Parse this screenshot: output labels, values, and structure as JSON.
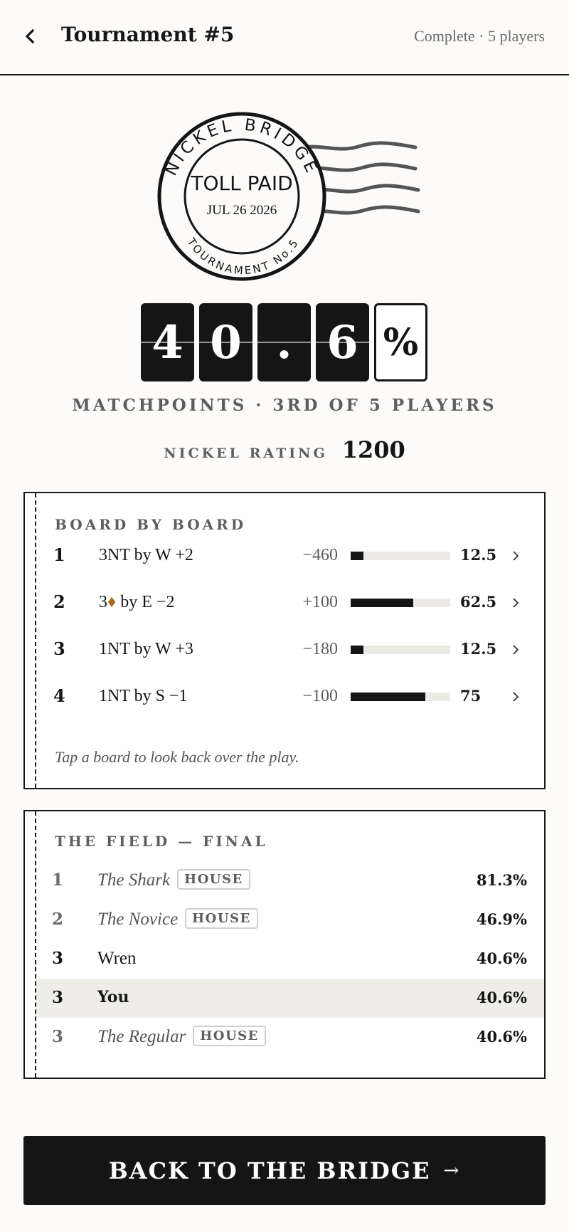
{
  "header": {
    "title": "Tournament #5",
    "status": "Complete · 5 players"
  },
  "stamp": {
    "ring_top": "NICKEL BRIDGE",
    "ring_bottom": "TOURNAMENT No.5",
    "center": "TOLL PAID",
    "date": "JUL 26 2026"
  },
  "score": {
    "digits": [
      "4",
      "0",
      ".",
      "6"
    ],
    "suffix": "%",
    "value_percent": 40.6,
    "summary": "MATCHPOINTS · 3RD OF 5 PLAYERS"
  },
  "rating": {
    "label": "NICKEL RATING",
    "value": "1200"
  },
  "boards": {
    "title": "BOARD BY BOARD",
    "rows": [
      {
        "num": "1",
        "contract_pre": "3NT",
        "contract_rest": " by W +2",
        "score": "−460",
        "mp": "12.5",
        "mp_fraction": 0.125
      },
      {
        "num": "2",
        "contract_pre": "3",
        "suit": "♦",
        "contract_rest": " by E −2",
        "score": "+100",
        "mp": "62.5",
        "mp_fraction": 0.625
      },
      {
        "num": "3",
        "contract_pre": "1NT",
        "contract_rest": " by W +3",
        "score": "−180",
        "mp": "12.5",
        "mp_fraction": 0.125
      },
      {
        "num": "4",
        "contract_pre": "1NT",
        "contract_rest": " by S −1",
        "score": "−100",
        "mp": "75",
        "mp_fraction": 0.75
      }
    ],
    "hint": "Tap a board to look back over the play."
  },
  "field": {
    "title": "THE FIELD — FINAL",
    "badge_label": "HOUSE",
    "rows": [
      {
        "rank": "1",
        "name": "The Shark",
        "house": true,
        "pct": "81.3%"
      },
      {
        "rank": "2",
        "name": "The Novice",
        "house": true,
        "pct": "46.9%"
      },
      {
        "rank": "3",
        "name": "Wren",
        "house": false,
        "pct": "40.6%"
      },
      {
        "rank": "3",
        "name": "You",
        "house": false,
        "me": true,
        "pct": "40.6%"
      },
      {
        "rank": "3",
        "name": "The Regular",
        "house": true,
        "pct": "40.6%"
      }
    ]
  },
  "cta": {
    "label": "BACK TO THE BRIDGE",
    "arrow": "→"
  },
  "colors": {
    "ink": "#151515",
    "paper": "#fcfbf9",
    "muted": "#5e5e5e",
    "diamond": "#a76a1a",
    "bar_track": "#ebeae5",
    "me_highlight": "#efede8"
  },
  "icons": {
    "back": "chevron-left-icon",
    "row_chevron": "chevron-right-icon"
  }
}
